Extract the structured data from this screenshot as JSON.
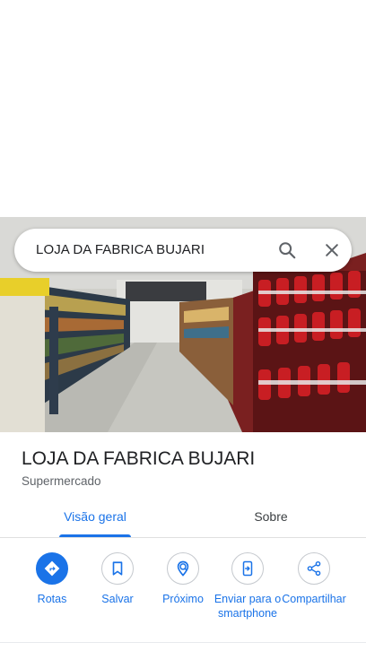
{
  "search": {
    "query": "LOJA DA FABRICA BUJARI"
  },
  "place": {
    "name": "LOJA DA FABRICA BUJARI",
    "category": "Supermercado"
  },
  "tabs": [
    {
      "label": "Visão geral",
      "active": true
    },
    {
      "label": "Sobre",
      "active": false
    }
  ],
  "actions": [
    {
      "label": "Rotas",
      "icon": "directions-icon"
    },
    {
      "label": "Salvar",
      "icon": "bookmark-icon"
    },
    {
      "label": "Próximo",
      "icon": "nearby-icon"
    },
    {
      "label": "Enviar para o smartphone",
      "icon": "send-to-phone-icon"
    },
    {
      "label": "Compartilhar",
      "icon": "share-icon"
    }
  ],
  "colors": {
    "accent": "#1a73e8",
    "text": "#202124",
    "secondary_text": "#5f6368",
    "divider": "#e0e0e0"
  }
}
